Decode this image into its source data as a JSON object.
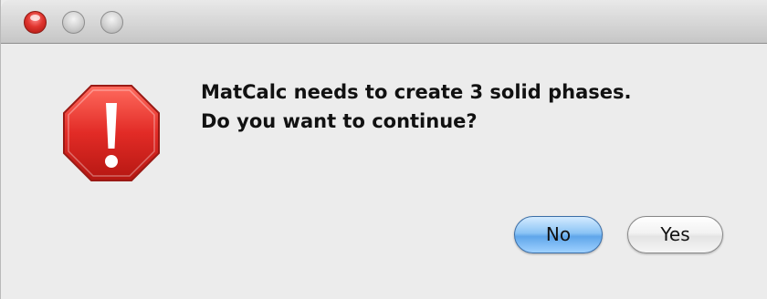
{
  "window": {
    "title": ""
  },
  "dialog": {
    "message_line1": "MatCalc needs to create 3 solid phases.",
    "message_line2": "Do you want to continue?",
    "icon": "stop-sign-exclamation-icon"
  },
  "buttons": {
    "no_label": "No",
    "yes_label": "Yes"
  },
  "colors": {
    "accent_button": "#5fa6ea",
    "alert_red": "#d92b2b",
    "background": "#ececec"
  }
}
